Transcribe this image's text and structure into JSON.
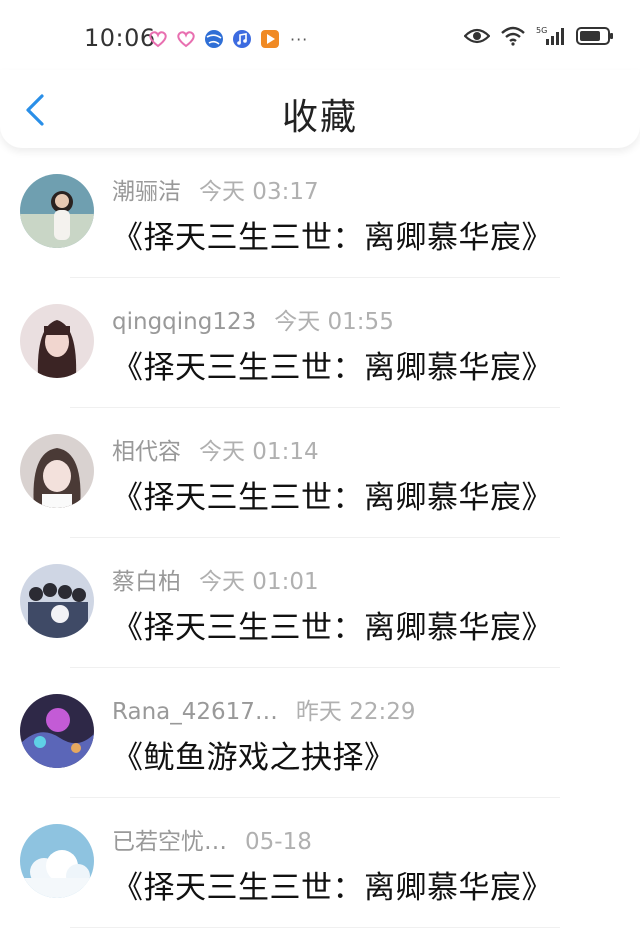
{
  "status_bar": {
    "time": "10:06",
    "more": "···",
    "network": "5G"
  },
  "header": {
    "title": "收藏"
  },
  "items": [
    {
      "name": "潮骊洁",
      "time": "今天 03:17",
      "book": "《择天三生三世：离卿慕华宸》"
    },
    {
      "name": "qingqing123",
      "time": "今天 01:55",
      "book": "《择天三生三世：离卿慕华宸》"
    },
    {
      "name": "相代容",
      "time": "今天 01:14",
      "book": "《择天三生三世：离卿慕华宸》"
    },
    {
      "name": "蔡白柏",
      "time": "今天 01:01",
      "book": "《择天三生三世：离卿慕华宸》"
    },
    {
      "name": "Rana_42617…",
      "time": "昨天 22:29",
      "book": "《鱿鱼游戏之抉择》"
    },
    {
      "name": "已若空忧…",
      "time": "05-18",
      "book": "《择天三生三世：离卿慕华宸》"
    }
  ],
  "colors": {
    "accent": "#2a8fe8",
    "meta_text": "#999999",
    "book_text": "#111111"
  }
}
